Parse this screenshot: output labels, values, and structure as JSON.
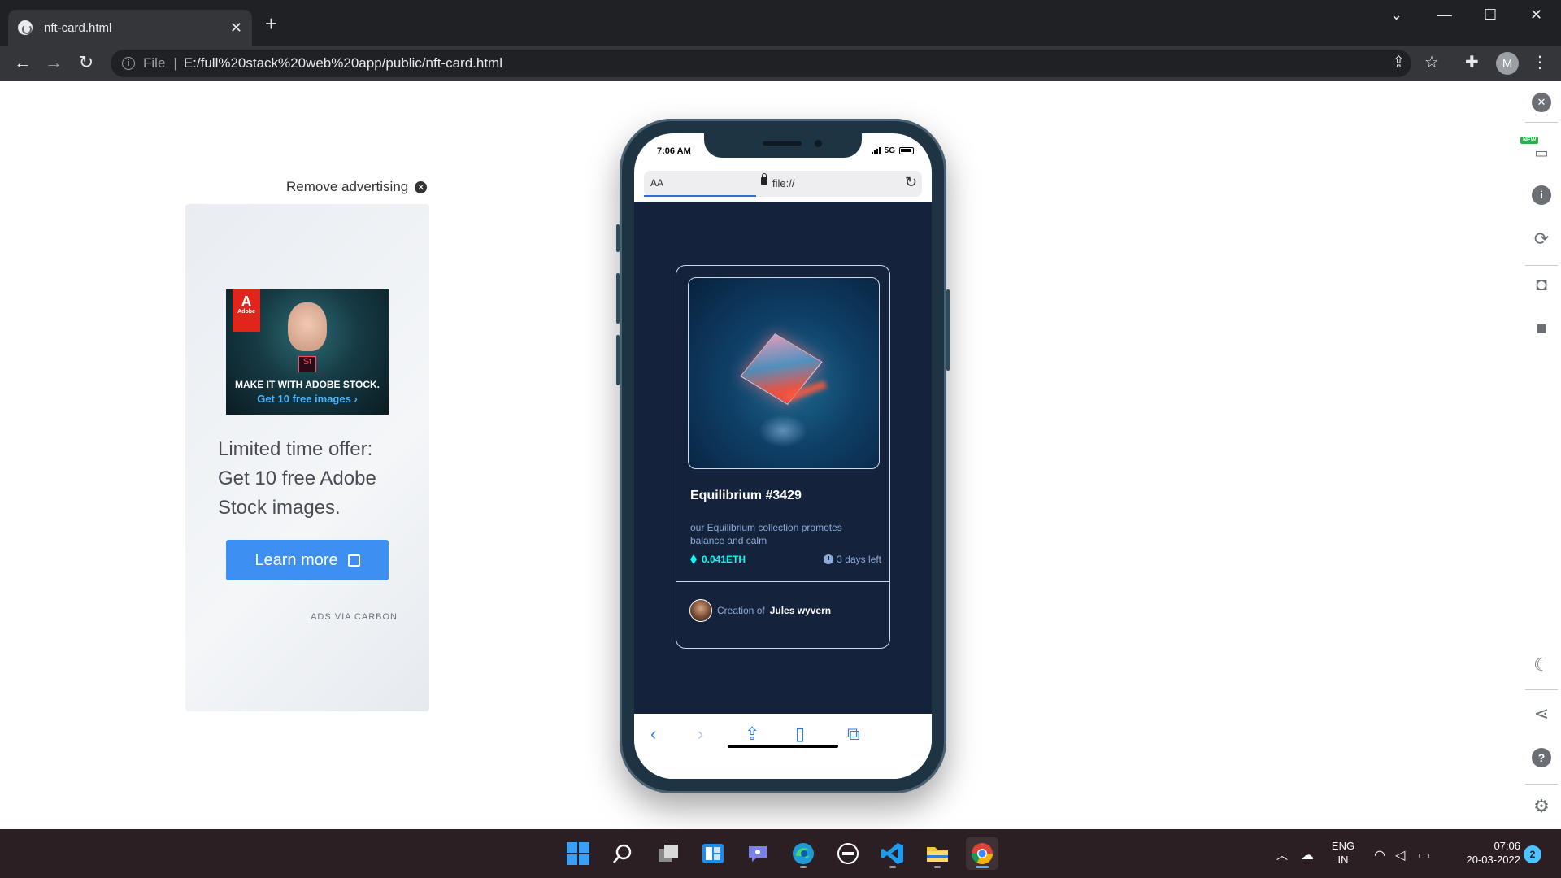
{
  "browser": {
    "tab_title": "nft-card.html",
    "tab_close": "✕",
    "new_tab": "+",
    "address_prefix": "File",
    "address_url": "E:/full%20stack%20web%20app/public/nft-card.html",
    "profile_initial": "M"
  },
  "ad": {
    "remove_label": "Remove advertising",
    "image_brand": "Adobe",
    "image_headline": "MAKE IT WITH ADOBE STOCK.",
    "image_sub": "Get 10 free images ›",
    "image_app": "St",
    "text": "Limited time offer: Get 10 free Adobe Stock images.",
    "button_label": "Learn more",
    "via": "ADS VIA CARBON"
  },
  "phone": {
    "time": "7:06 AM",
    "network": "5G",
    "addr_aa": "AA",
    "addr_url": "file://"
  },
  "nft": {
    "title": "Equilibrium #3429",
    "description": "our Equilibrium collection promotes balance and calm",
    "price": "0.041ETH",
    "days_left": "3 days left",
    "creator_label": "Creation of",
    "creator_name": "Jules wyvern"
  },
  "taskbar": {
    "lang_top": "ENG",
    "lang_bottom": "IN",
    "time": "07:06",
    "date": "20-03-2022",
    "notifications": "2"
  },
  "colors": {
    "card_bg": "#14233b",
    "accent_cyan": "#00fff8",
    "soft_blue": "#8bacd9",
    "ad_button": "#3d8ff2"
  }
}
